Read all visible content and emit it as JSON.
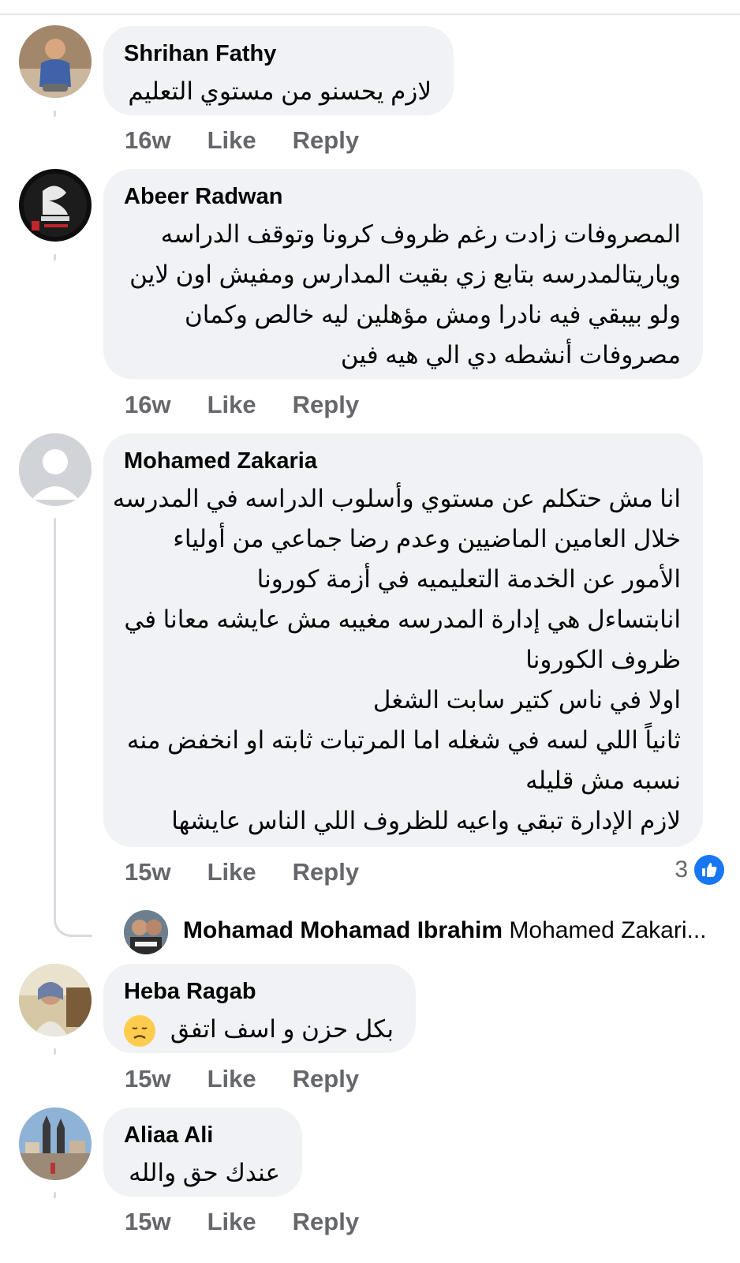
{
  "comments": [
    {
      "author": "Shrihan Fathy",
      "lines": [
        "لازم يحسنو من مستوي التعليم"
      ],
      "time": "16w",
      "like": "Like",
      "reply": "Reply",
      "avatar": "child-photo-avatar"
    },
    {
      "author": "Abeer Radwan",
      "lines": [
        "المصروفات  زادت رغم ظروف كرونا وتوقف الدراسه",
        "وياريتالمدرسه بتابع زي بقيت المدارس ومفيش اون لاين",
        "ولو بيبقي فيه نادرا ومش مؤهلين ليه خالص وكمان",
        "مصروفات أنشطه دي الي هيه فين"
      ],
      "time": "16w",
      "like": "Like",
      "reply": "Reply",
      "avatar": "calligraphy-avatar"
    },
    {
      "author": "Mohamed Zakaria",
      "lines": [
        "انا مش حتكلم عن مستوي وأسلوب الدراسه في المدرسه",
        "خلال العامين الماضيين وعدم رضا جماعي من أولياء",
        "الأمور عن الخدمة التعليميه في أزمة كورونا",
        "انابتساءل هي إدارة المدرسه مغيبه مش عايشه معانا في",
        "ظروف الكورونا",
        "اولا في ناس كتير سابت الشغل",
        "ثانياً اللي لسه في شغله اما المرتبات ثابته او انخفض منه",
        "نسبه مش قليله",
        "لازم الإدارة تبقي واعيه للظروف اللي الناس عايشها"
      ],
      "time": "15w",
      "like": "Like",
      "reply": "Reply",
      "reaction_count": "3",
      "avatar": "default-user-avatar",
      "reply_preview": {
        "author": "Mohamad Mohamad Ibrahim",
        "snippet": "Mohamed Zakari..."
      }
    },
    {
      "author": "Heba Ragab",
      "lines": [
        "بكل حزن و اسف اتفق"
      ],
      "emoji": "disappointed-face",
      "time": "15w",
      "like": "Like",
      "reply": "Reply",
      "avatar": "woman-photo-avatar"
    },
    {
      "author": "Aliaa Ali",
      "lines": [
        "عندك حق والله"
      ],
      "time": "15w",
      "like": "Like",
      "reply": "Reply",
      "avatar": "city-photo-avatar"
    }
  ],
  "colors": {
    "bubble": "#f0f2f5",
    "text": "#050505",
    "meta": "#65676b",
    "like_blue": "#1877f2",
    "thread_line": "#d8dadf"
  }
}
